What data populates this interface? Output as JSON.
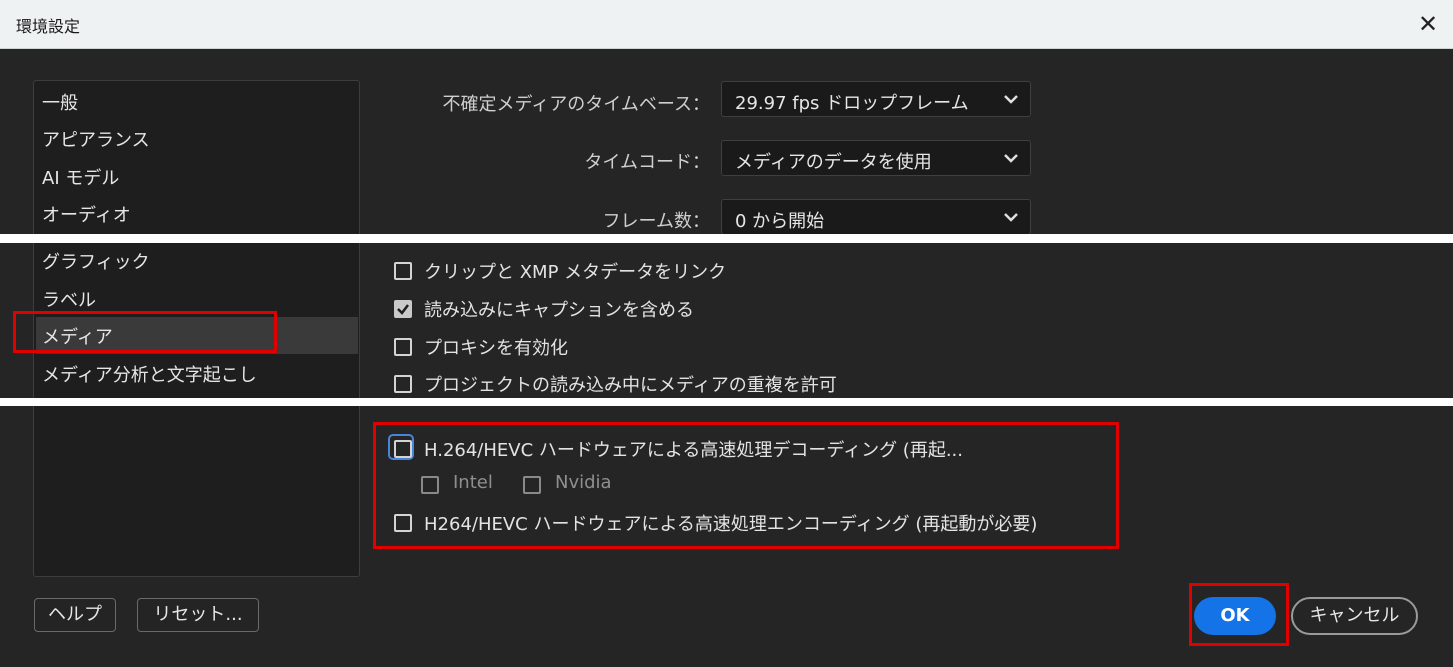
{
  "window": {
    "title": "環境設定",
    "close_icon": "close-icon"
  },
  "sidebar": {
    "items": [
      "一般",
      "アピアランス",
      "AI モデル",
      "オーディオ",
      "グラフィック",
      "ラベル",
      "メディア",
      "メディア分析と文字起こし"
    ],
    "selected": "メディア"
  },
  "settings": {
    "timebase_label": "不確定メディアのタイムベース：",
    "timebase_value": "29.97 fps ドロップフレーム",
    "timecode_label": "タイムコード：",
    "timecode_value": "メディアのデータを使用",
    "frames_label": "フレーム数：",
    "frames_value": "0 から開始"
  },
  "checkboxes": {
    "xmp_link": {
      "label": "クリップと XMP メタデータをリンク",
      "checked": false
    },
    "captions": {
      "label": "読み込みにキャプションを含める",
      "checked": true
    },
    "proxies": {
      "label": "プロキシを有効化",
      "checked": false
    },
    "duplicates": {
      "label": "プロジェクトの読み込み中にメディアの重複を許可",
      "checked": false
    },
    "hw_decode": {
      "label": "H.264/HEVC ハードウェアによる高速処理デコーディング (再起...",
      "checked": false
    },
    "intel": {
      "label": "Intel",
      "checked": false
    },
    "nvidia": {
      "label": "Nvidia",
      "checked": false
    },
    "hw_encode": {
      "label": "H264/HEVC ハードウェアによる高速処理エンコーディング (再起動が必要)",
      "checked": false
    }
  },
  "buttons": {
    "help": "ヘルプ",
    "reset": "リセット...",
    "ok": "OK",
    "cancel": "キャンセル"
  },
  "colors": {
    "highlight_red": "#e00000",
    "ok_blue": "#1473e6",
    "background": "#252525",
    "focus_blue": "#4a84d9"
  }
}
